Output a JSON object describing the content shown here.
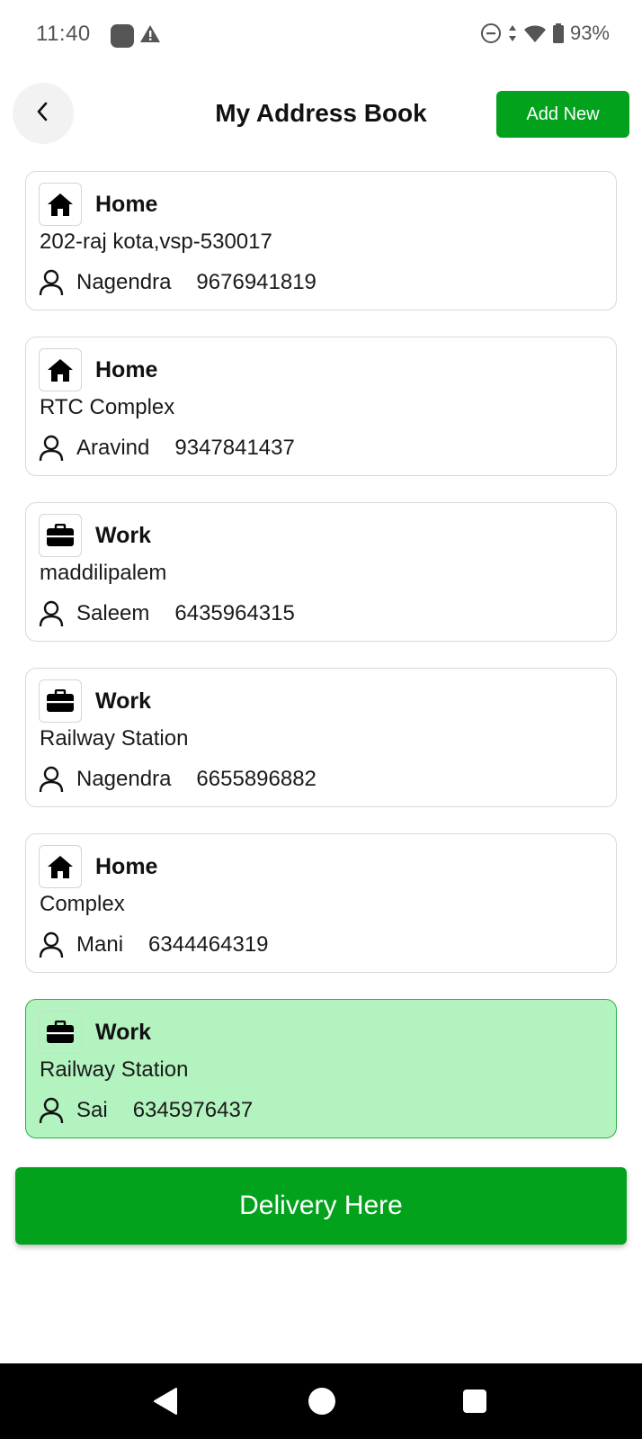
{
  "status_bar": {
    "time": "11:40",
    "battery": "93%",
    "icons": [
      "app-icon",
      "warning-icon",
      "do-not-disturb-icon",
      "data-arrows-icon",
      "wifi-icon",
      "battery-icon"
    ]
  },
  "header": {
    "title": "My Address Book",
    "add_new_label": "Add New",
    "back_icon": "chevron-left-icon"
  },
  "addresses": [
    {
      "type": "Home",
      "icon": "home-icon",
      "address": "202-raj kota,vsp-530017",
      "name": "Nagendra",
      "phone": "9676941819",
      "selected": false
    },
    {
      "type": "Home",
      "icon": "home-icon",
      "address": "RTC Complex",
      "name": "Aravind",
      "phone": "9347841437",
      "selected": false
    },
    {
      "type": "Work",
      "icon": "briefcase-icon",
      "address": "maddilipalem",
      "name": "Saleem",
      "phone": "6435964315",
      "selected": false
    },
    {
      "type": "Work",
      "icon": "briefcase-icon",
      "address": "Railway Station",
      "name": "Nagendra",
      "phone": "6655896882",
      "selected": false
    },
    {
      "type": "Home",
      "icon": "home-icon",
      "address": "Complex",
      "name": "Mani",
      "phone": "6344464319",
      "selected": false
    },
    {
      "type": "Work",
      "icon": "briefcase-icon",
      "address": "Railway Station",
      "name": "Sai",
      "phone": "6345976437",
      "selected": true
    }
  ],
  "delivery_label": "Delivery Here",
  "colors": {
    "primary_green": "#02a21d",
    "selected_card_bg": "#b3f3bf",
    "selected_card_border": "#2bb043"
  }
}
